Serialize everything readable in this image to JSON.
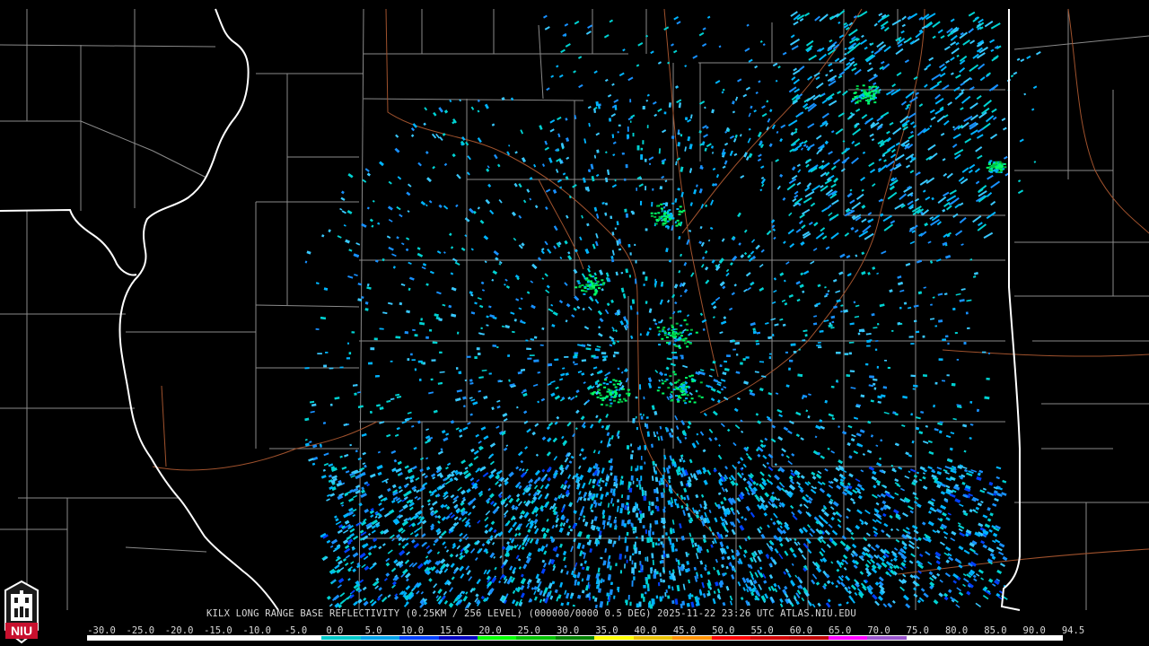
{
  "caption": "KILX LONG RANGE BASE REFLECTIVITY (0.25KM / 256 LEVEL) (000000/0000 0.5 DEG) 2025-11-22 23:26 UTC  ATLAS.NIU.EDU",
  "logo": {
    "text": "NIU",
    "color": "#c8102e"
  },
  "color_scale": {
    "labels": [
      "-30.0",
      "-25.0",
      "-20.0",
      "-15.0",
      "-10.0",
      "-5.0",
      "0.0",
      "5.0",
      "10.0",
      "15.0",
      "20.0",
      "25.0",
      "30.0",
      "35.0",
      "40.0",
      "45.0",
      "50.0",
      "55.0",
      "60.0",
      "65.0",
      "70.0",
      "75.0",
      "80.0",
      "85.0",
      "90.0",
      "94.5"
    ],
    "colors": [
      "#ffffff",
      "#ffffff",
      "#ffffff",
      "#ffffff",
      "#ffffff",
      "#ffffff",
      "#00c8c8",
      "#00a0e8",
      "#0040ff",
      "#0000c0",
      "#00ff00",
      "#00c000",
      "#008000",
      "#ffff00",
      "#e8c000",
      "#ff9000",
      "#ff0000",
      "#d00000",
      "#c00000",
      "#ff00ff",
      "#9955cc",
      "#ffffff",
      "#ffffff",
      "#ffffff",
      "#ffffff"
    ]
  },
  "map": {
    "state_border_color": "#ffffff",
    "county_border_color": "#8a8a8a",
    "highway_color": "#a0522d",
    "echo_colors": [
      "#00b4ff",
      "#1890ff",
      "#00d2d2",
      "#38c8ff",
      "#0060ff",
      "#00ff66",
      "#00c040"
    ],
    "radar_site": "KILX"
  }
}
